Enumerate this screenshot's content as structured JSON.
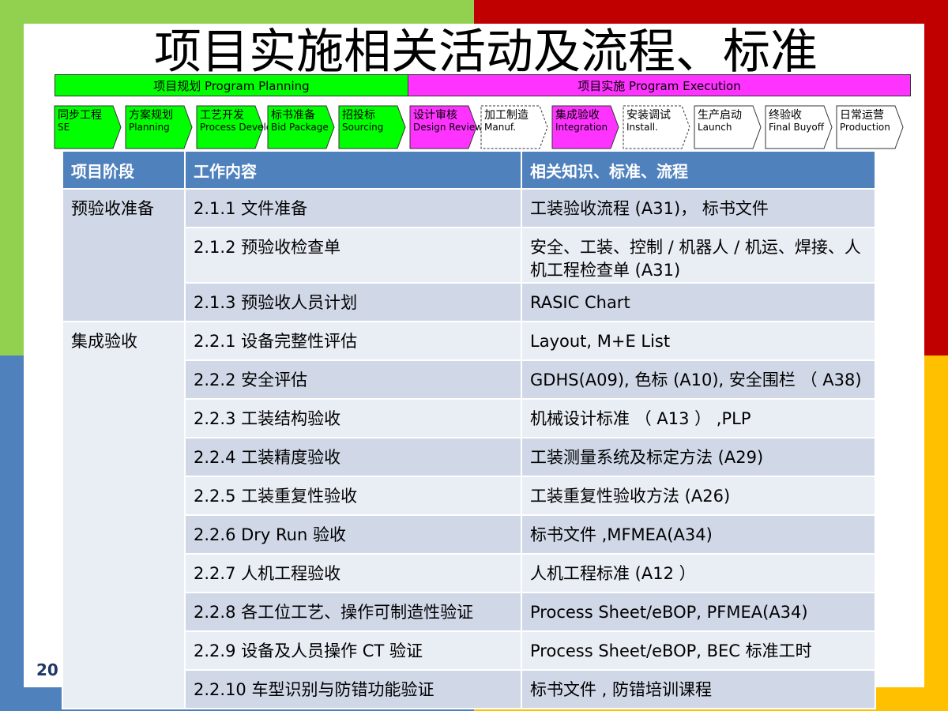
{
  "title": "项目实施相关活动及流程、标准",
  "phases": {
    "planning": "项目规划   Program Planning",
    "execution": "项目实施   Program Execution"
  },
  "colors": {
    "green": "#00ff00",
    "magenta": "#ff33ff",
    "header_blue": "#4f81bd",
    "row_dark": "#d0d8e8",
    "row_light": "#e9edf4"
  },
  "steps": [
    {
      "cn": "同步工程",
      "en": "SE",
      "fill": "#00ff00"
    },
    {
      "cn": "方案规划",
      "en": "Planning",
      "fill": "#00ff00"
    },
    {
      "cn": "工艺开发",
      "en": "Process Development",
      "fill": "#00ff00"
    },
    {
      "cn": "标书准备",
      "en": "Bid Package",
      "fill": "#00ff00"
    },
    {
      "cn": "招投标",
      "en": "Sourcing",
      "fill": "#00ff00"
    },
    {
      "cn": "设计审核",
      "en": "Design Review",
      "fill": "#ff33ff"
    },
    {
      "cn": "加工制造",
      "en": "Manuf.",
      "fill": "#ffffff"
    },
    {
      "cn": "集成验收",
      "en": "Integration",
      "fill": "#ff33ff"
    },
    {
      "cn": "安装调试",
      "en": "Install.",
      "fill": "#ffffff"
    },
    {
      "cn": "生产启动",
      "en": "Launch",
      "fill": "#ffffff"
    },
    {
      "cn": "终验收",
      "en": "Final Buyoff",
      "fill": "#ffffff"
    },
    {
      "cn": "日常运营",
      "en": "Production",
      "fill": "#ffffff"
    }
  ],
  "table": {
    "headers": [
      "项目阶段",
      "工作内容",
      "相关知识、标准、流程"
    ],
    "groups": [
      {
        "phase": "预验收准备",
        "rows": [
          {
            "work": "2.1.1  文件准备",
            "ref": "工装验收流程 (A31)，  标书文件"
          },
          {
            "work": "2.1.2  预验收检查单",
            "ref": "安全、工装、控制 / 机器人 / 机运、焊接、人机工程检查单 (A31)"
          },
          {
            "work": "2.1.3  预验收人员计划",
            "ref": "RASIC Chart"
          }
        ]
      },
      {
        "phase": "集成验收",
        "rows": [
          {
            "work": "2.2.1  设备完整性评估",
            "ref": "Layout, M+E List"
          },
          {
            "work": "2.2.2  安全评估",
            "ref": "GDHS(A09), 色标 (A10), 安全围栏  （ A38)"
          },
          {
            "work": "2.2.3  工装结构验收",
            "ref": "机械设计标准  （  A13 ）  ,PLP"
          },
          {
            "work": "2.2.4  工装精度验收",
            "ref": "工装测量系统及标定方法 (A29)"
          },
          {
            "work": "2.2.5  工装重复性验收",
            "ref": "工装重复性验收方法 (A26)"
          },
          {
            "work": "2.2.6 Dry Run 验收",
            "ref": "标书文件 ,MFMEA(A34)"
          },
          {
            "work": "2.2.7  人机工程验收",
            "ref": "人机工程标准 (A12 ）"
          },
          {
            "work": "2.2.8  各工位工艺、操作可制造性验证",
            "ref": "Process Sheet/eBOP, PFMEA(A34)"
          },
          {
            "work": "2.2.9 设备及人员操作 CT 验证",
            "ref": "Process Sheet/eBOP, BEC 标准工时"
          },
          {
            "work": "2.2.10 车型识别与防错功能验证",
            "ref": "标书文件 , 防错培训课程"
          }
        ]
      }
    ]
  },
  "footer": {
    "year_partial": "20"
  }
}
